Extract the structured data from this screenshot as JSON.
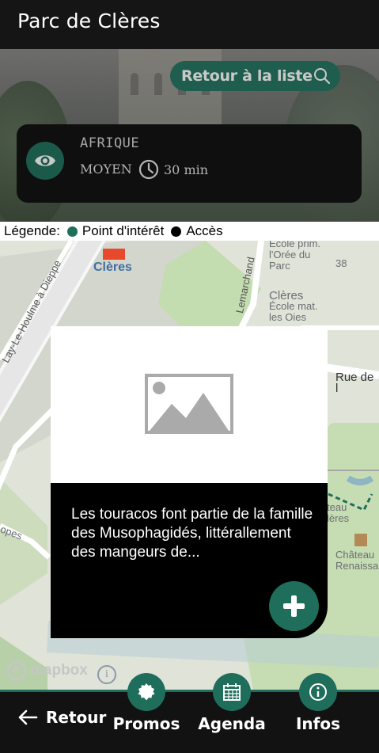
{
  "header": {
    "title": "Parc de Clères"
  },
  "hero": {
    "back_to_list_label": "Retour à la liste"
  },
  "poi": {
    "name": "AFRIQUE",
    "level": "MOYEN",
    "duration": "30 min"
  },
  "legend": {
    "prefix": "Légende:",
    "items": [
      {
        "label": "Point d'intérêt",
        "color": "#1f6e5c"
      },
      {
        "label": "Accès",
        "color": "#000000"
      }
    ]
  },
  "map": {
    "labels": {
      "station": "Clères",
      "school_prim": "École prim.\nl'Orée du\nParc",
      "number": "38",
      "town": "Clères",
      "school_mat": "École mat.\nles Oies",
      "lemarchand": "Lemarchand",
      "rue_de": "Rue de l",
      "road": "Lay-Le-Houlme à Dieppe",
      "hau": "teau\nlères",
      "chateau": "Château\nRenaissa",
      "opes": "opes"
    },
    "attribution": "mapbox"
  },
  "popup": {
    "text": "Les touracos font partie de la famille des Musophagidés, littérallement des mangeurs de..."
  },
  "footer": {
    "back_label": "Retour",
    "tabs": [
      {
        "label": "Promos"
      },
      {
        "label": "Agenda"
      },
      {
        "label": "Infos"
      }
    ]
  },
  "colors": {
    "accent": "#1f6e5c",
    "dark": "#121212"
  }
}
